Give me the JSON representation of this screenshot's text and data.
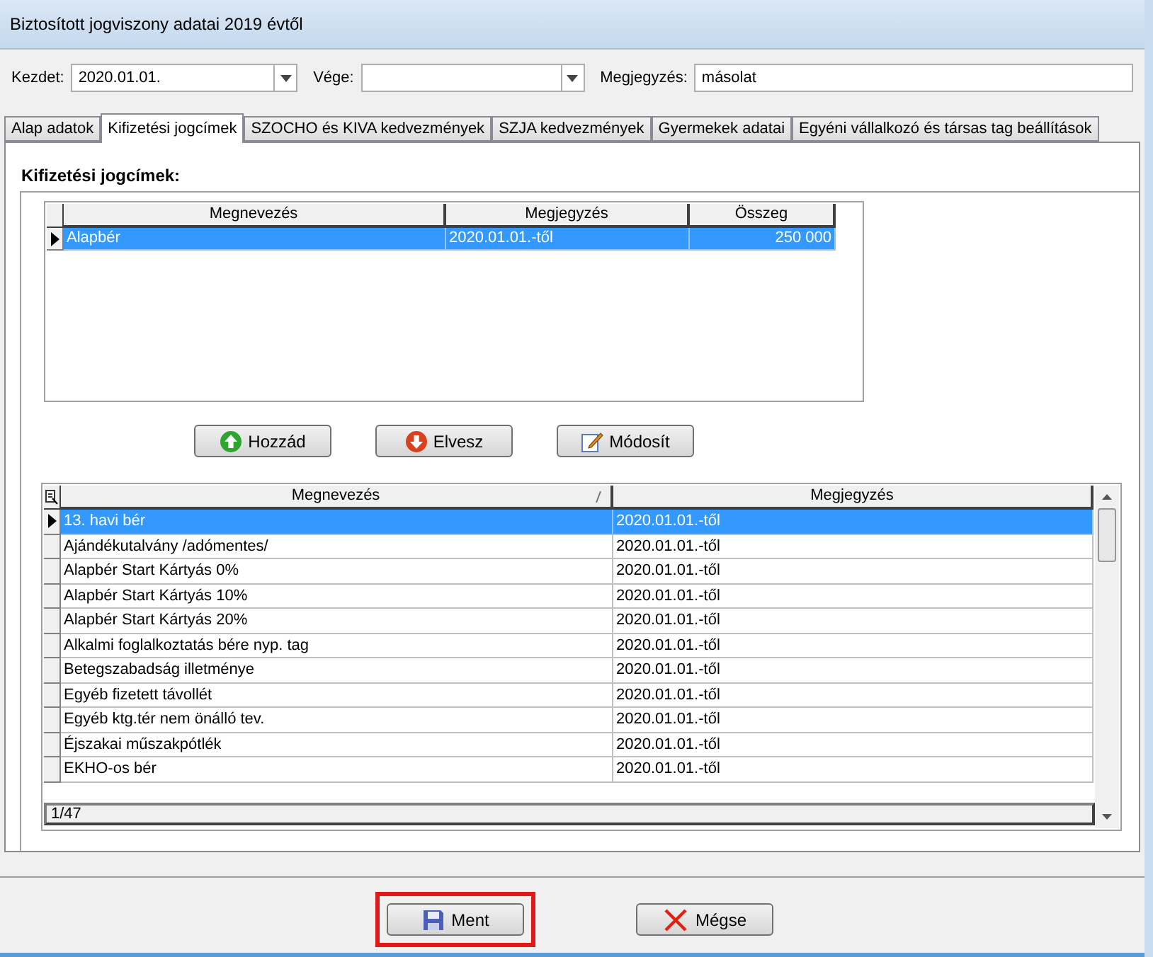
{
  "window": {
    "title": "Biztosított jogviszony adatai 2019 évtől"
  },
  "filters": [
    {
      "kind": "combo",
      "label": "Kezdet:",
      "value": "2020.01.01."
    },
    {
      "kind": "combo",
      "label": "Vége:"
    },
    {
      "kind": "text",
      "label": "Megjegyzés:",
      "value": "másolat"
    }
  ],
  "tabs": [
    {
      "label": "Alap adatok",
      "selected": false
    },
    {
      "label": "Kifizetési jogcímek",
      "selected": true
    },
    {
      "label": "SZOCHO és KIVA kedvezmények",
      "selected": false
    },
    {
      "label": "SZJA kedvezmények",
      "selected": false
    },
    {
      "label": "Gyermekek adatai",
      "selected": false
    },
    {
      "label": "Egyéni vállalkozó és társas tag beállítások",
      "selected": false
    }
  ],
  "section_title": "Kifizetési jogcímek:",
  "selected_table": {
    "columns": [
      "Megnevezés",
      "Megjegyzés",
      "Összeg"
    ],
    "rows": [
      {
        "cells": [
          "Alapbér",
          "2020.01.01.-től",
          "250 000"
        ],
        "selected": true
      }
    ]
  },
  "actions": [
    {
      "kind": "add",
      "label": "Hozzád"
    },
    {
      "kind": "remove",
      "label": "Elvesz"
    },
    {
      "kind": "edit",
      "label": "Módosít"
    }
  ],
  "list_table": {
    "columns": [
      "Megnevezés",
      "Megjegyzés"
    ],
    "rows": [
      {
        "cells": [
          "13. havi bér",
          "2020.01.01.-től"
        ],
        "selected": true
      },
      {
        "cells": [
          "Ajándékutalvány /adómentes/",
          "2020.01.01.-től"
        ],
        "selected": false
      },
      {
        "cells": [
          "Alapbér Start Kártyás 0%",
          "2020.01.01.-től"
        ],
        "selected": false
      },
      {
        "cells": [
          "Alapbér Start Kártyás 10%",
          "2020.01.01.-től"
        ],
        "selected": false
      },
      {
        "cells": [
          "Alapbér Start Kártyás 20%",
          "2020.01.01.-től"
        ],
        "selected": false
      },
      {
        "cells": [
          "Alkalmi foglalkoztatás bére nyp. tag",
          "2020.01.01.-től"
        ],
        "selected": false
      },
      {
        "cells": [
          "Betegszabadság illetménye",
          "2020.01.01.-től"
        ],
        "selected": false
      },
      {
        "cells": [
          "Egyéb fizetett távollét",
          "2020.01.01.-től"
        ],
        "selected": false
      },
      {
        "cells": [
          "Egyéb ktg.tér nem önálló tev.",
          "2020.01.01.-től"
        ],
        "selected": false
      },
      {
        "cells": [
          "Éjszakai műszakpótlék",
          "2020.01.01.-től"
        ],
        "selected": false
      },
      {
        "cells": [
          "EKHO-os bér",
          "2020.01.01.-től"
        ],
        "selected": false
      }
    ],
    "footer": "1/47"
  },
  "buttons": [
    {
      "kind": "save",
      "label": "Ment",
      "highlighted": true
    },
    {
      "kind": "cancel",
      "label": "Mégse",
      "highlighted": false
    }
  ]
}
